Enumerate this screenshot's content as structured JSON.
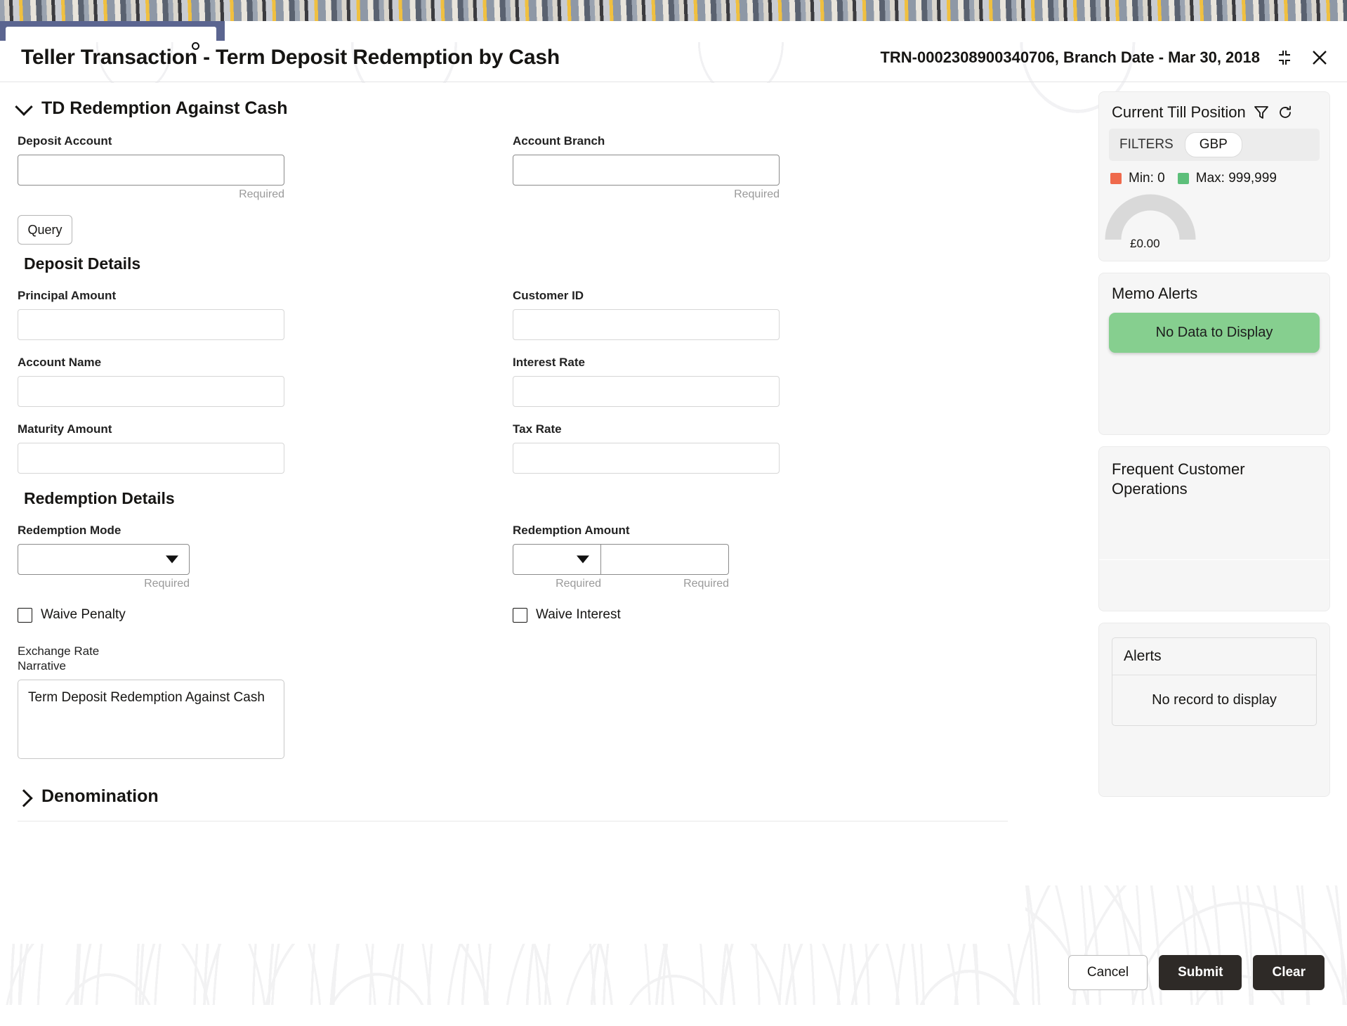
{
  "header": {
    "title": "Teller Transaction - Term Deposit Redemption by Cash",
    "transaction_ref": "TRN-0002308900340706, Branch Date - Mar 30, 2018",
    "minimize_icon": "collapse-corners-icon",
    "close_icon": "close-icon"
  },
  "form": {
    "section_title": "TD Redemption Against Cash",
    "deposit_account": {
      "label": "Deposit Account",
      "value": "",
      "helper": "Required"
    },
    "account_branch": {
      "label": "Account Branch",
      "value": "",
      "helper": "Required"
    },
    "query_button": "Query",
    "deposit_details_title": "Deposit Details",
    "principal_amount": {
      "label": "Principal Amount",
      "value": ""
    },
    "customer_id": {
      "label": "Customer ID",
      "value": ""
    },
    "account_name": {
      "label": "Account Name",
      "value": ""
    },
    "interest_rate": {
      "label": "Interest Rate",
      "value": ""
    },
    "maturity_amount": {
      "label": "Maturity Amount",
      "value": ""
    },
    "tax_rate": {
      "label": "Tax Rate",
      "value": ""
    },
    "redemption_details_title": "Redemption Details",
    "redemption_mode": {
      "label": "Redemption Mode",
      "value": "",
      "helper": "Required"
    },
    "redemption_amount": {
      "label": "Redemption Amount",
      "currency_value": "",
      "currency_helper": "Required",
      "amount_value": "",
      "amount_helper": "Required"
    },
    "waive_penalty": {
      "label": "Waive Penalty",
      "checked": false
    },
    "waive_interest": {
      "label": "Waive Interest",
      "checked": false
    },
    "exchange_rate_label": "Exchange Rate",
    "narrative": {
      "label": "Narrative",
      "value": "Term Deposit Redemption Against Cash"
    },
    "denomination_title": "Denomination"
  },
  "rail": {
    "till": {
      "title": "Current Till Position",
      "filter_icon": "funnel-icon",
      "refresh_icon": "refresh-icon",
      "filters_label": "FILTERS",
      "currency_pill": "GBP",
      "min_label": "Min: 0",
      "max_label": "Max: 999,999",
      "min_color": "#ef6a4c",
      "max_color": "#5dbf7a",
      "gauge_value": "£0.00",
      "gauge_track_color": "#d9d9d9"
    },
    "memo": {
      "title": "Memo Alerts",
      "empty_text": "No Data to Display",
      "empty_color": "#86cf8f"
    },
    "fco": {
      "title": "Frequent Customer Operations"
    },
    "alerts": {
      "title": "Alerts",
      "empty_text": "No record to display"
    }
  },
  "footer": {
    "cancel": "Cancel",
    "submit": "Submit",
    "clear": "Clear"
  }
}
